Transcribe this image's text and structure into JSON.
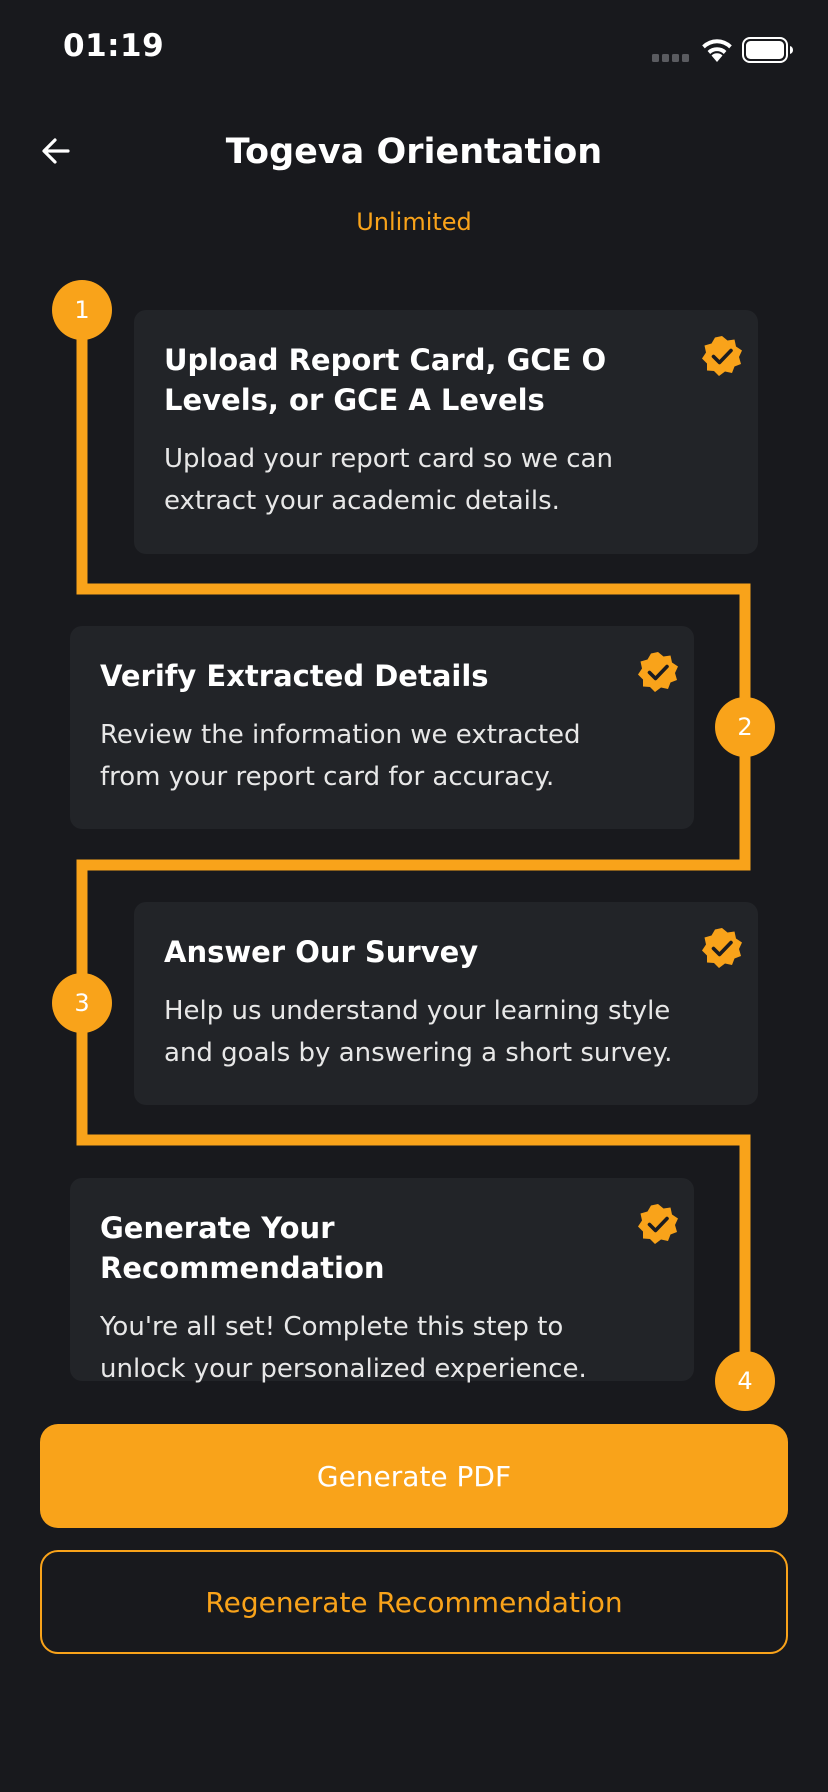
{
  "status_bar": {
    "time": "01:19",
    "icons": [
      "signal-icon",
      "wifi-icon",
      "battery-icon"
    ]
  },
  "header": {
    "back_icon": "arrow-left-icon",
    "title": "Togeva Orientation",
    "plan": "Unlimited"
  },
  "colors": {
    "background": "#18191d",
    "card": "#222428",
    "accent": "#f9a31a",
    "text": "#ffffff"
  },
  "steps": [
    {
      "number": "1",
      "title": "Upload Report Card, GCE O Levels, or GCE A Levels",
      "description": "Upload your report card so we can extract your academic details.",
      "completed": true
    },
    {
      "number": "2",
      "title": "Verify Extracted Details",
      "description": "Review the information we extracted from your report card for accuracy.",
      "completed": true
    },
    {
      "number": "3",
      "title": "Answer Our Survey",
      "description": "Help us understand your learning style and goals by answering a short survey.",
      "completed": true
    },
    {
      "number": "4",
      "title": "Generate Your Recommendation",
      "description": "You're all set! Complete this step to unlock your personalized experience.",
      "completed": true
    }
  ],
  "actions": {
    "primary_label": "Generate PDF",
    "secondary_label": "Regenerate Recommendation"
  }
}
